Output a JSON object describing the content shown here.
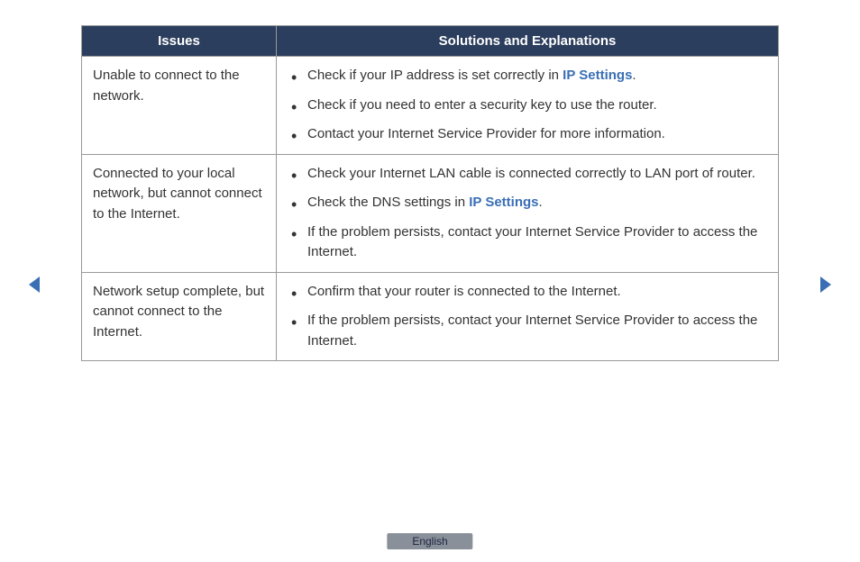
{
  "headers": {
    "issues": "Issues",
    "solutions": "Solutions and Explanations"
  },
  "rows": [
    {
      "issue": "Unable to connect to the network.",
      "solutions": [
        {
          "pre": "Check if your IP address is set correctly in ",
          "link": "IP Settings",
          "post": "."
        },
        {
          "pre": "Check if you need to enter a security key to use the router.",
          "link": "",
          "post": ""
        },
        {
          "pre": "Contact your Internet Service Provider for more information.",
          "link": "",
          "post": ""
        }
      ]
    },
    {
      "issue": "Connected to your local network, but cannot connect to the Internet.",
      "solutions": [
        {
          "pre": "Check your Internet LAN cable is connected correctly to LAN port of router.",
          "link": "",
          "post": ""
        },
        {
          "pre": "Check the DNS settings in ",
          "link": "IP Settings",
          "post": "."
        },
        {
          "pre": "If the problem persists, contact your Internet Service Provider to access the Internet.",
          "link": "",
          "post": ""
        }
      ]
    },
    {
      "issue": "Network setup complete, but cannot connect to the Internet.",
      "solutions": [
        {
          "pre": "Confirm that your router is connected to the Internet.",
          "link": "",
          "post": ""
        },
        {
          "pre": "If the problem persists, contact your Internet Service Provider to access the Internet.",
          "link": "",
          "post": ""
        }
      ]
    }
  ],
  "language": "English",
  "colors": {
    "navArrow": "#3a6fb5"
  }
}
